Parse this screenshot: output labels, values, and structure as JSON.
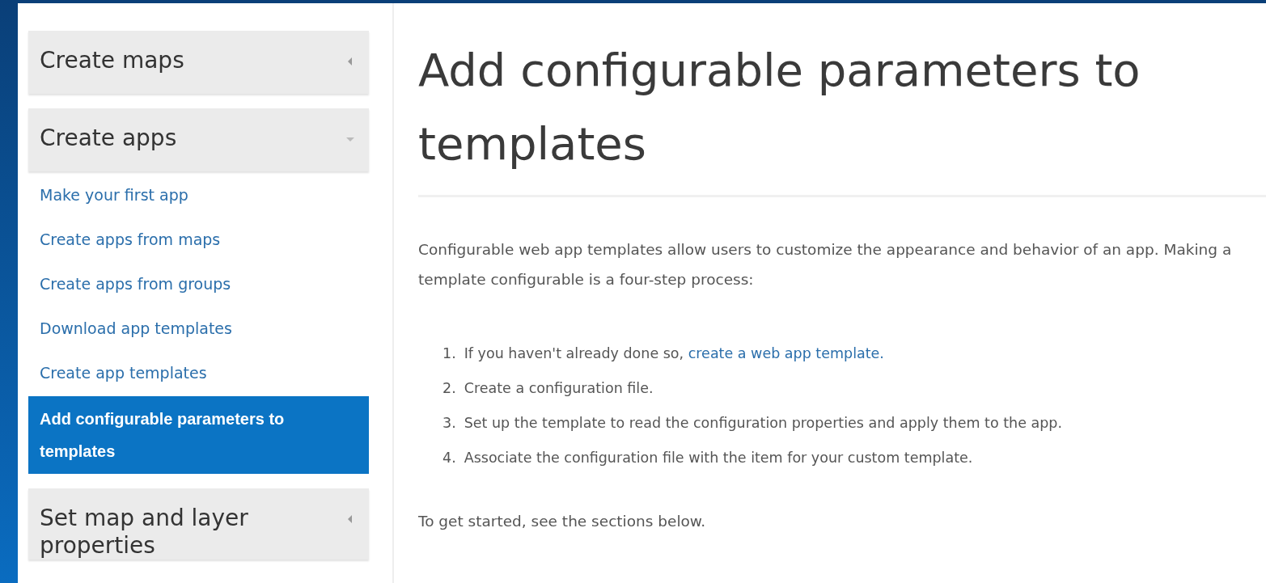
{
  "sidebar": {
    "sections": [
      {
        "title": "Create maps",
        "expanded": false
      },
      {
        "title": "Create apps",
        "expanded": true,
        "items": [
          {
            "label": "Make your first app",
            "selected": false
          },
          {
            "label": "Create apps from maps",
            "selected": false
          },
          {
            "label": "Create apps from groups",
            "selected": false
          },
          {
            "label": "Download app templates",
            "selected": false
          },
          {
            "label": "Create app templates",
            "selected": false
          },
          {
            "label": "Add configurable parameters to templates",
            "selected": true
          }
        ]
      },
      {
        "title": "Set map and layer properties",
        "expanded": false
      }
    ]
  },
  "article": {
    "title": "Add configurable parameters to templates",
    "intro": "Configurable web app templates allow users to customize the appearance and behavior of an app. Making a template configurable is a four-step process:",
    "steps": [
      {
        "number": "1.",
        "text": "If you haven't already done so,",
        "link": "create a web app template."
      },
      {
        "number": "2.",
        "text": "Create a configuration file."
      },
      {
        "number": "3.",
        "text": "Set up the template to read the configuration properties and apply them to the app."
      },
      {
        "number": "4.",
        "text": "Associate the configuration file with the item for your custom template."
      }
    ],
    "outro": "To get started, see the sections below."
  }
}
